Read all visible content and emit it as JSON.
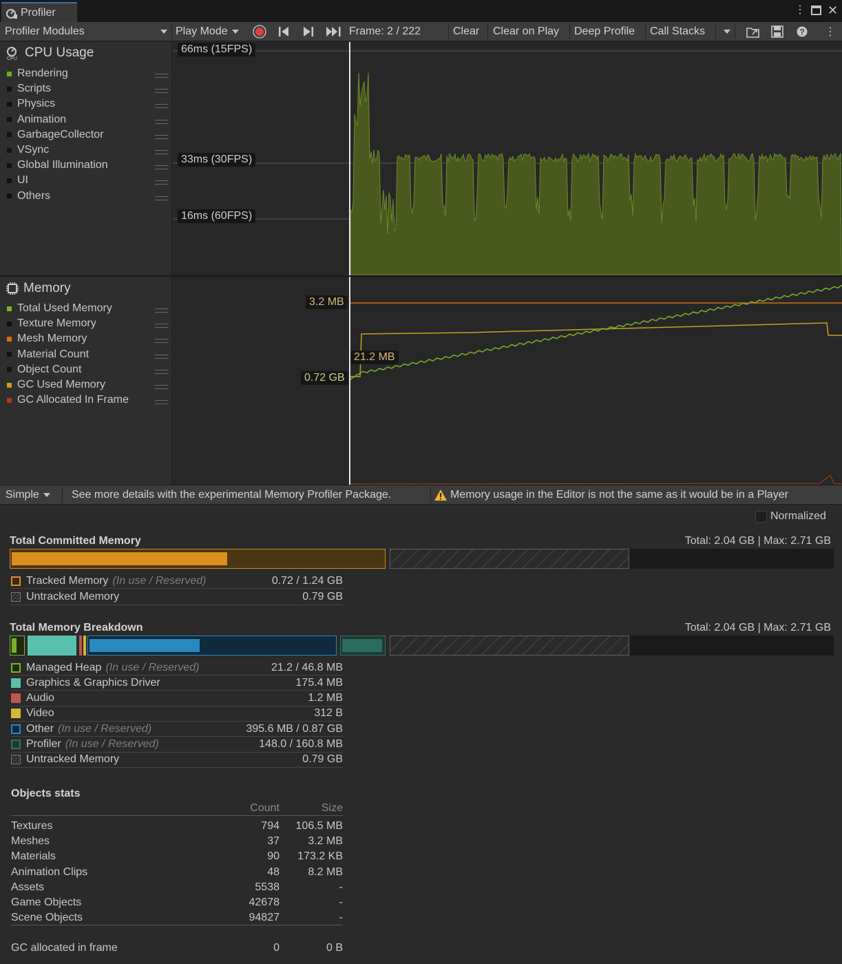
{
  "window": {
    "tab_title": "Profiler"
  },
  "toolbar": {
    "modules_dropdown": "Profiler Modules",
    "play_mode": "Play Mode",
    "frame": "Frame: 2 / 222",
    "clear": "Clear",
    "clear_on_play": "Clear on Play",
    "deep_profile": "Deep Profile",
    "call_stacks": "Call Stacks"
  },
  "cpu": {
    "title": "CPU Usage",
    "legend": [
      {
        "label": "Rendering",
        "color": "#64b01e"
      },
      {
        "label": "Scripts",
        "color": "#111111"
      },
      {
        "label": "Physics",
        "color": "#111111"
      },
      {
        "label": "Animation",
        "color": "#111111"
      },
      {
        "label": "GarbageCollector",
        "color": "#111111"
      },
      {
        "label": "VSync",
        "color": "#111111"
      },
      {
        "label": "Global Illumination",
        "color": "#111111"
      },
      {
        "label": "UI",
        "color": "#111111"
      },
      {
        "label": "Others",
        "color": "#111111"
      }
    ],
    "thresholds": [
      "66ms (15FPS)",
      "33ms (30FPS)",
      "16ms (60FPS)"
    ],
    "fill_color": "#4a5a1e"
  },
  "memory": {
    "title": "Memory",
    "legend": [
      {
        "label": "Total Used Memory",
        "color": "#7fb02e"
      },
      {
        "label": "Texture Memory",
        "color": "#111111"
      },
      {
        "label": "Mesh Memory",
        "color": "#d46f12"
      },
      {
        "label": "Material Count",
        "color": "#111111"
      },
      {
        "label": "Object Count",
        "color": "#111111"
      },
      {
        "label": "GC Used Memory",
        "color": "#c5a021"
      },
      {
        "label": "GC Allocated In Frame",
        "color": "#b0381b"
      }
    ],
    "labels": [
      "3.2 MB",
      "21.2 MB",
      "0.72 GB"
    ]
  },
  "status": {
    "mode": "Simple",
    "hint": "See more details with the experimental Memory Profiler Package.",
    "warning": "Memory usage in the Editor is not the same as it would be in a Player"
  },
  "details": {
    "normalized_label": "Normalized",
    "committed": {
      "title": "Total Committed Memory",
      "totals": "Total: 2.04 GB | Max: 2.71 GB",
      "tracked_fill": 0.58,
      "rows": [
        {
          "label": "Tracked Memory",
          "note": "(In use / Reserved)",
          "value": "0.72 / 1.24 GB"
        },
        {
          "label": "Untracked Memory",
          "note": "",
          "value": "0.79 GB"
        }
      ]
    },
    "breakdown": {
      "title": "Total Memory Breakdown",
      "totals": "Total: 2.04 GB | Max: 2.71 GB",
      "rows": [
        {
          "label": "Managed Heap",
          "note": "(In use / Reserved)",
          "value": "21.2 / 46.8 MB"
        },
        {
          "label": "Graphics & Graphics Driver",
          "note": "",
          "value": "175.4 MB"
        },
        {
          "label": "Audio",
          "note": "",
          "value": "1.2 MB"
        },
        {
          "label": "Video",
          "note": "",
          "value": "312 B"
        },
        {
          "label": "Other",
          "note": "(In use / Reserved)",
          "value": "395.6 MB / 0.87 GB"
        },
        {
          "label": "Profiler",
          "note": "(In use / Reserved)",
          "value": "148.0 / 160.8 MB"
        },
        {
          "label": "Untracked Memory",
          "note": "",
          "value": "0.79 GB"
        }
      ]
    },
    "objects": {
      "title": "Objects stats",
      "col_count": "Count",
      "col_size": "Size",
      "rows": [
        {
          "name": "Textures",
          "count": "794",
          "size": "106.5 MB"
        },
        {
          "name": "Meshes",
          "count": "37",
          "size": "3.2 MB"
        },
        {
          "name": "Materials",
          "count": "90",
          "size": "173.2 KB"
        },
        {
          "name": "Animation Clips",
          "count": "48",
          "size": "8.2 MB"
        },
        {
          "name": "Assets",
          "count": "5538",
          "size": "-"
        },
        {
          "name": "Game Objects",
          "count": "42678",
          "size": "-"
        },
        {
          "name": "Scene Objects",
          "count": "94827",
          "size": "-"
        }
      ],
      "gc": {
        "name": "GC allocated in frame",
        "count": "0",
        "size": "0 B"
      }
    }
  }
}
